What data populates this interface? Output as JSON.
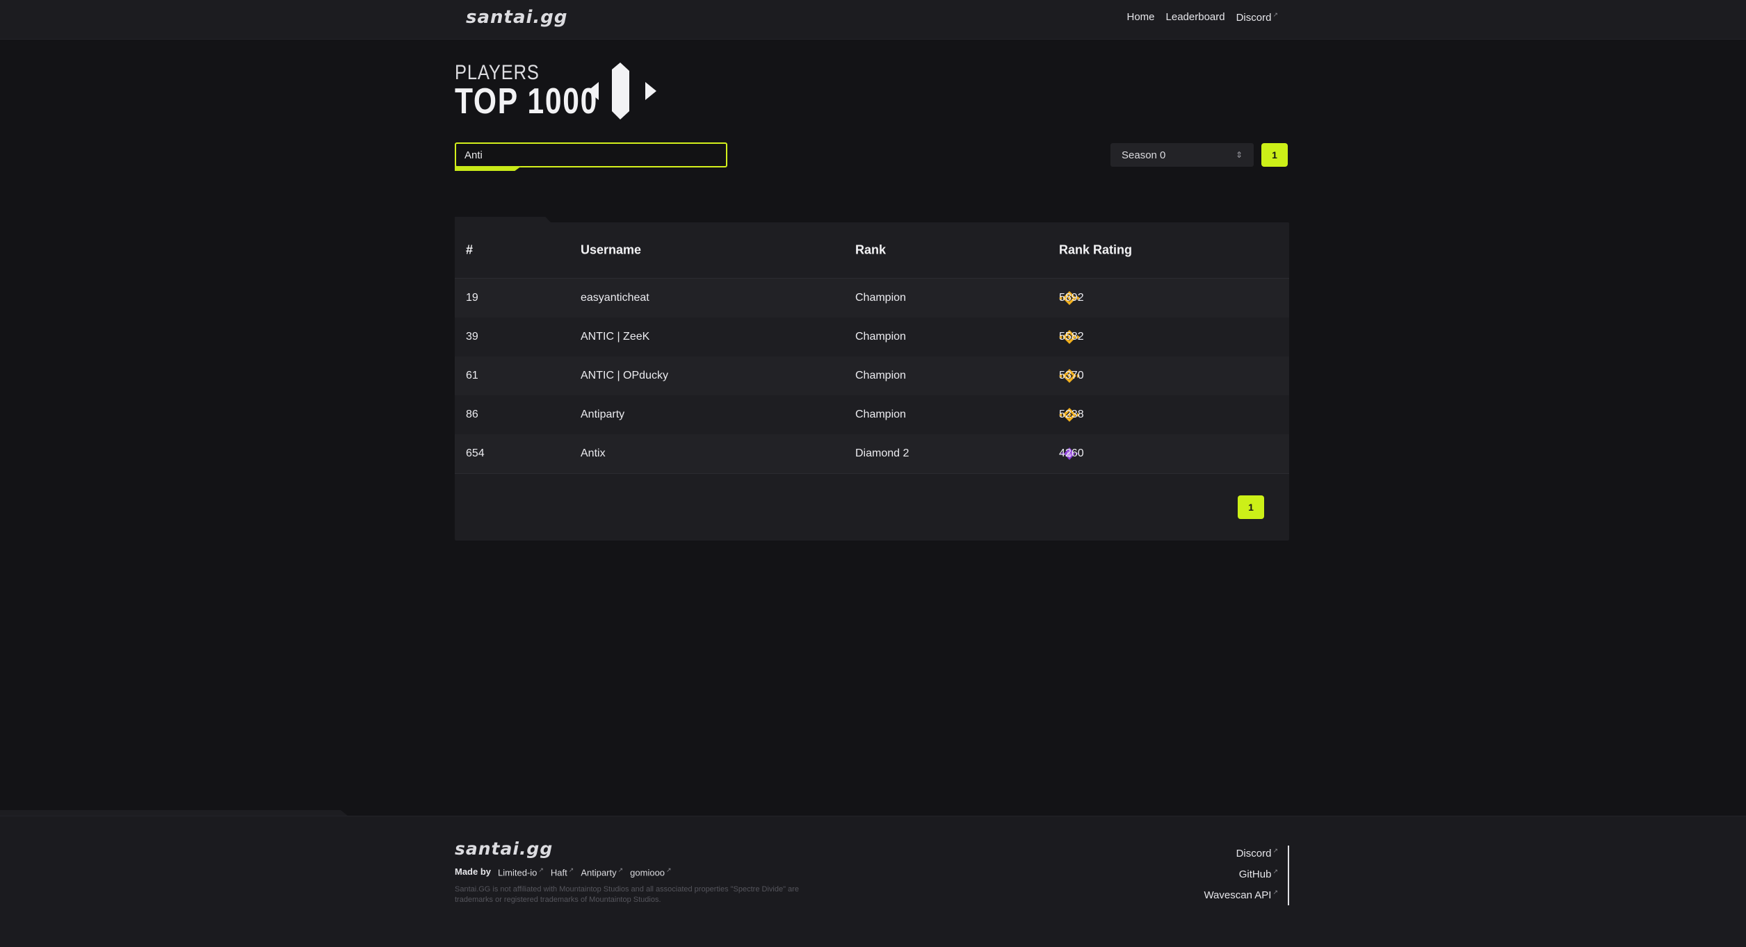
{
  "header": {
    "logo": "santai.gg",
    "nav": [
      {
        "label": "Home",
        "external": false
      },
      {
        "label": "Leaderboard",
        "external": false
      },
      {
        "label": "Discord",
        "external": true
      }
    ]
  },
  "title": {
    "small": "PLAYERS",
    "big": "TOP 1000"
  },
  "search": {
    "value": "Anti"
  },
  "season_select": {
    "value": "Season 0"
  },
  "pagination_top": {
    "current": "1"
  },
  "table": {
    "columns": [
      "#",
      "Username",
      "Rank",
      "Rank Rating"
    ],
    "rows": [
      {
        "pos": "19",
        "username": "easyanticheat",
        "rank": "Champion",
        "rating": "5892",
        "icon": "champion-rank-icon"
      },
      {
        "pos": "39",
        "username": "ANTIC | ZeeK",
        "rank": "Champion",
        "rating": "5582",
        "icon": "champion-rank-icon"
      },
      {
        "pos": "61",
        "username": "ANTIC | OPducky",
        "rank": "Champion",
        "rating": "5370",
        "icon": "champion-rank-icon"
      },
      {
        "pos": "86",
        "username": "Antiparty",
        "rank": "Champion",
        "rating": "5238",
        "icon": "champion-rank-icon"
      },
      {
        "pos": "654",
        "username": "Antix",
        "rank": "Diamond 2",
        "rating": "4260",
        "icon": "diamond-rank-icon"
      }
    ],
    "pagination": {
      "current": "1"
    }
  },
  "footer": {
    "logo": "santai.gg",
    "made_by_label": "Made by",
    "authors": [
      "Limited-io",
      "Haft",
      "Antiparty",
      "gomiooo"
    ],
    "disclaimer": "Santai.GG is not affiliated with Mountaintop Studios and all associated properties \"Spectre Divide\" are trademarks or registered trademarks of Mountaintop Studios.",
    "links": [
      "Discord",
      "GitHub",
      "Wavescan API"
    ]
  },
  "colors": {
    "accent": "#ccf018",
    "champion": "#f2b01e",
    "diamond": "#8a3fd6",
    "background": "#131316",
    "card": "#1e1e22"
  }
}
